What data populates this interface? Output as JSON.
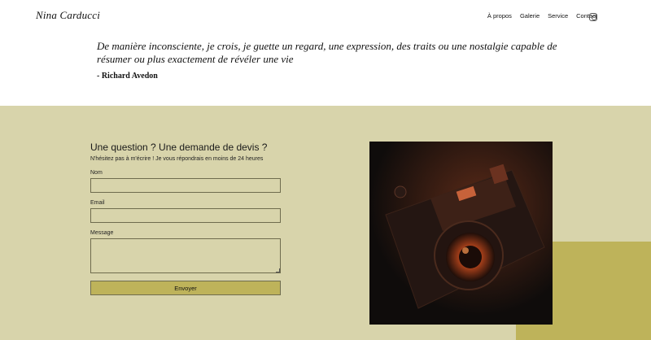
{
  "header": {
    "brand": "Nina Carducci",
    "nav": [
      "À propos",
      "Galerie",
      "Service",
      "Contact"
    ],
    "social_icon": "instagram-icon"
  },
  "quote": {
    "text": "De manière inconsciente, je crois, je guette un regard, une expression, des traits ou une nostalgie capable de résumer ou plus exactement de révéler une vie",
    "author": "- Richard Avedon"
  },
  "contact": {
    "title": "Une question ? Une demande de devis ?",
    "subtitle": "N'hésitez pas à m'écrire ! Je vous répondrais en moins de 24 heures",
    "name_label": "Nom",
    "email_label": "Email",
    "message_label": "Message",
    "submit_label": "Envoyer"
  },
  "image": {
    "subject": "camera-photo"
  },
  "colors": {
    "section_bg": "#d8d4ab",
    "accent": "#beb35a",
    "border": "#6f6c4e"
  }
}
